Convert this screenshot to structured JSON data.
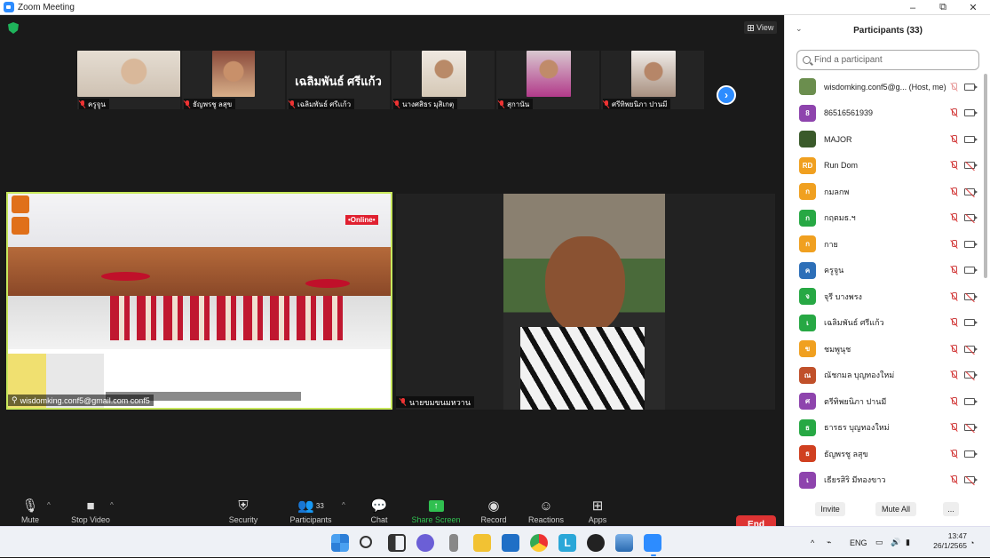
{
  "window": {
    "title": "Zoom Meeting",
    "min": "–",
    "max": "⧉",
    "close": "✕"
  },
  "view_label": "View",
  "strip": [
    {
      "name": "ครูจูน",
      "color": "#d9cfc4"
    },
    {
      "name": "ธัญพรชู ลสุข",
      "color": "#c88860"
    },
    {
      "name": "เฉลิมพันธ์ ศรีแก้ว",
      "big": "เฉลิมพันธ์  ศรีแก้ว"
    },
    {
      "name": "นางศสิธร มุสิเกตุ",
      "color": "#c8b7a0"
    },
    {
      "name": "สุกานัน",
      "color": "#d19aa0"
    },
    {
      "name": "ศรีทิพยนิภา ปานมี",
      "color": "#b7a496"
    }
  ],
  "tiles": {
    "main_name": "wisdomking.conf5@gmail.com conf5",
    "online_badge": "•Online•",
    "second_name": "นายขมขนมหวาน"
  },
  "controls": {
    "mute": "Mute",
    "stop_video": "Stop Video",
    "security": "Security",
    "participants": "Participants",
    "participants_count": "33",
    "chat": "Chat",
    "share": "Share Screen",
    "record": "Record",
    "reactions": "Reactions",
    "apps": "Apps",
    "end": "End"
  },
  "panel": {
    "title": "Participants (33)",
    "search_placeholder": "Find a participant",
    "invite": "Invite",
    "mute_all": "Mute All",
    "more": "...",
    "participants": [
      {
        "initial": "",
        "name": "wisdomking.conf5@g... (Host, me)",
        "color": "#6b8e4e",
        "mic": "on",
        "cam": "on"
      },
      {
        "initial": "8",
        "name": "86516561939",
        "color": "#8e44ad",
        "mic": "off",
        "cam": "on"
      },
      {
        "initial": "",
        "name": "MAJOR",
        "color": "#3a5a2a",
        "mic": "off",
        "cam": "on"
      },
      {
        "initial": "RD",
        "name": "Run Dom",
        "color": "#f0a020",
        "mic": "off",
        "cam": "off"
      },
      {
        "initial": "ก",
        "name": "กมลกพ",
        "color": "#f0a020",
        "mic": "off",
        "cam": "off"
      },
      {
        "initial": "ก",
        "name": "กฤตมธ.ฯ",
        "color": "#27a844",
        "mic": "off",
        "cam": "off"
      },
      {
        "initial": "ก",
        "name": "กาย",
        "color": "#f0a020",
        "mic": "off",
        "cam": "on"
      },
      {
        "initial": "ค",
        "name": "ครูจูน",
        "color": "#2d6fb8",
        "mic": "off",
        "cam": "on"
      },
      {
        "initial": "จ",
        "name": "จุรี  บางพรง",
        "color": "#27a844",
        "mic": "off",
        "cam": "off"
      },
      {
        "initial": "เ",
        "name": "เฉลิมพันธ์ ศรีแก้ว",
        "color": "#27a844",
        "mic": "off",
        "cam": "on"
      },
      {
        "initial": "ข",
        "name": "ชมพูนุช",
        "color": "#f0a020",
        "mic": "off",
        "cam": "off"
      },
      {
        "initial": "ณ",
        "name": "ณัชกมล  บุญทองใหม่",
        "color": "#c0502a",
        "mic": "off",
        "cam": "off"
      },
      {
        "initial": "ศ",
        "name": "ตรีทิพยนิภา ปานมี",
        "color": "#8e44ad",
        "mic": "off",
        "cam": "on"
      },
      {
        "initial": "ธ",
        "name": "ธารธร บุญทองใหม่",
        "color": "#27a844",
        "mic": "off",
        "cam": "off"
      },
      {
        "initial": "ธ",
        "name": "ธัญพรชู ลสุข",
        "color": "#d04020",
        "mic": "off",
        "cam": "on"
      },
      {
        "initial": "เ",
        "name": "เธียรสิริ       มีทองขาว",
        "color": "#8e44ad",
        "mic": "off",
        "cam": "off"
      }
    ]
  },
  "taskbar": {
    "lang": "ENG",
    "time": "13:47",
    "date": "26/1/2565"
  }
}
